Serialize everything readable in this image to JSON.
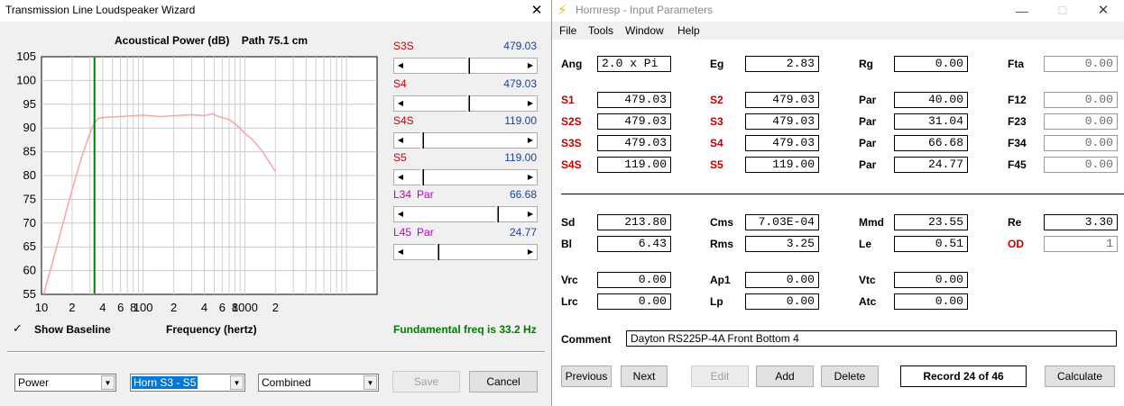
{
  "wizard": {
    "title": "Transmission Line Loudspeaker Wizard",
    "close_glyph": "✕",
    "chart_header": {
      "quantity": "Acoustical Power (dB)",
      "path": "Path 75.1 cm"
    },
    "sliders": [
      {
        "label": "S3S",
        "value": "479.03",
        "position": 0.52
      },
      {
        "label": "S4",
        "value": "479.03",
        "position": 0.52
      },
      {
        "label": "S4S",
        "value": "119.00",
        "position": 0.12
      },
      {
        "label": "S5",
        "value": "119.00",
        "position": 0.12
      },
      {
        "label": "L34",
        "label2": "Par",
        "value": "66.68",
        "position": 0.78
      },
      {
        "label": "L45",
        "label2": "Par",
        "value": "24.77",
        "position": 0.25
      }
    ],
    "show_baseline": {
      "check": "✓",
      "label": "Show Baseline",
      "checked": true
    },
    "x_axis_title": "Frequency (hertz)",
    "fundamental": "Fundamental freq is 33.2 Hz",
    "combos": [
      {
        "value": "Power",
        "arrow": "▼"
      },
      {
        "value": "Horn S3 - S5",
        "arrow": "▼"
      },
      {
        "value": "Combined",
        "arrow": "▼"
      }
    ],
    "buttons": {
      "save": "Save",
      "cancel": "Cancel"
    },
    "arrows": {
      "left": "◀",
      "right": "▶"
    }
  },
  "chart_data": {
    "type": "line",
    "xscale": "log",
    "xlim": [
      10,
      20000
    ],
    "ylim": [
      55,
      105
    ],
    "yticks": [
      55,
      60,
      65,
      70,
      75,
      80,
      85,
      90,
      95,
      100,
      105
    ],
    "xtick_labels": [
      {
        "x": 10,
        "label": "10"
      },
      {
        "x": 20,
        "label": "2"
      },
      {
        "x": 40,
        "label": "4"
      },
      {
        "x": 60,
        "label": "6"
      },
      {
        "x": 80,
        "label": "8"
      },
      {
        "x": 100,
        "label": "100"
      },
      {
        "x": 200,
        "label": "2"
      },
      {
        "x": 400,
        "label": "4"
      },
      {
        "x": 600,
        "label": "6"
      },
      {
        "x": 800,
        "label": "8"
      },
      {
        "x": 1000,
        "label": "1000"
      },
      {
        "x": 2000,
        "label": "2"
      }
    ],
    "grid": true,
    "marker_frequency": 33.2,
    "series_color": "#f4aaaa",
    "marker_color": "#008000",
    "series": [
      {
        "x": [
          10.5,
          15,
          20,
          25,
          30,
          33,
          36,
          40,
          50,
          70,
          100,
          150,
          200,
          300,
          400,
          480,
          550,
          700,
          800,
          1000,
          1200,
          1500,
          2000
        ],
        "y": [
          55,
          67,
          77,
          84,
          89,
          91,
          92,
          92.2,
          92.3,
          92.5,
          92.7,
          92.4,
          92.6,
          92.8,
          92.6,
          93.0,
          92.4,
          91.8,
          90.9,
          88.9,
          87.5,
          85.0,
          80.8
        ]
      }
    ]
  },
  "hornresp": {
    "title": "Hornresp - Input Parameters",
    "icon": "⚡",
    "controls": {
      "min": "—",
      "max": "☐",
      "close": "✕"
    },
    "menu": [
      "File",
      "Tools",
      "Window",
      "Help"
    ],
    "rows1": [
      [
        {
          "label": "Ang",
          "value": "2.0 x Pi",
          "red": false
        },
        {
          "label": "Eg",
          "value": "2.83",
          "red": false
        },
        {
          "label": "Rg",
          "value": "0.00",
          "red": false
        },
        {
          "label": "Fta",
          "value": "0.00",
          "red": false,
          "grey": true
        }
      ]
    ],
    "rows2": [
      [
        {
          "label": "S1",
          "value": "479.03",
          "red": true
        },
        {
          "label": "S2",
          "value": "479.03",
          "red": true
        },
        {
          "label": "Par",
          "value": "40.00",
          "red": false
        },
        {
          "label": "F12",
          "value": "0.00",
          "red": false,
          "grey": true
        }
      ],
      [
        {
          "label": "S2S",
          "value": "479.03",
          "red": true
        },
        {
          "label": "S3",
          "value": "479.03",
          "red": true
        },
        {
          "label": "Par",
          "value": "31.04",
          "red": false
        },
        {
          "label": "F23",
          "value": "0.00",
          "red": false,
          "grey": true
        }
      ],
      [
        {
          "label": "S3S",
          "value": "479.03",
          "red": true
        },
        {
          "label": "S4",
          "value": "479.03",
          "red": true
        },
        {
          "label": "Par",
          "value": "66.68",
          "red": false
        },
        {
          "label": "F34",
          "value": "0.00",
          "red": false,
          "grey": true
        }
      ],
      [
        {
          "label": "S4S",
          "value": "119.00",
          "red": true
        },
        {
          "label": "S5",
          "value": "119.00",
          "red": true
        },
        {
          "label": "Par",
          "value": "24.77",
          "red": false
        },
        {
          "label": "F45",
          "value": "0.00",
          "red": false,
          "grey": true
        }
      ]
    ],
    "rows3": [
      [
        {
          "label": "Sd",
          "value": "213.80",
          "red": false
        },
        {
          "label": "Cms",
          "value": "7.03E-04",
          "red": false
        },
        {
          "label": "Mmd",
          "value": "23.55",
          "red": false
        },
        {
          "label": "Re",
          "value": "3.30",
          "red": false
        }
      ],
      [
        {
          "label": "Bl",
          "value": "6.43",
          "red": false
        },
        {
          "label": "Rms",
          "value": "3.25",
          "red": false
        },
        {
          "label": "Le",
          "value": "0.51",
          "red": false
        },
        {
          "label": "OD",
          "value": "1",
          "red": true,
          "grey": true
        }
      ]
    ],
    "rows4": [
      [
        {
          "label": "Vrc",
          "value": "0.00",
          "red": false
        },
        {
          "label": "Ap1",
          "value": "0.00",
          "red": false
        },
        {
          "label": "Vtc",
          "value": "0.00",
          "red": false
        }
      ],
      [
        {
          "label": "Lrc",
          "value": "0.00",
          "red": false
        },
        {
          "label": "Lp",
          "value": "0.00",
          "red": false
        },
        {
          "label": "Atc",
          "value": "0.00",
          "red": false
        }
      ]
    ],
    "comment_label": "Comment",
    "comment": "Dayton RS225P-4A Front Bottom 4",
    "buttons": {
      "previous": "Previous",
      "next": "Next",
      "edit": "Edit",
      "add": "Add",
      "delete": "Delete",
      "calculate": "Calculate"
    },
    "record": "Record 24 of 46"
  }
}
